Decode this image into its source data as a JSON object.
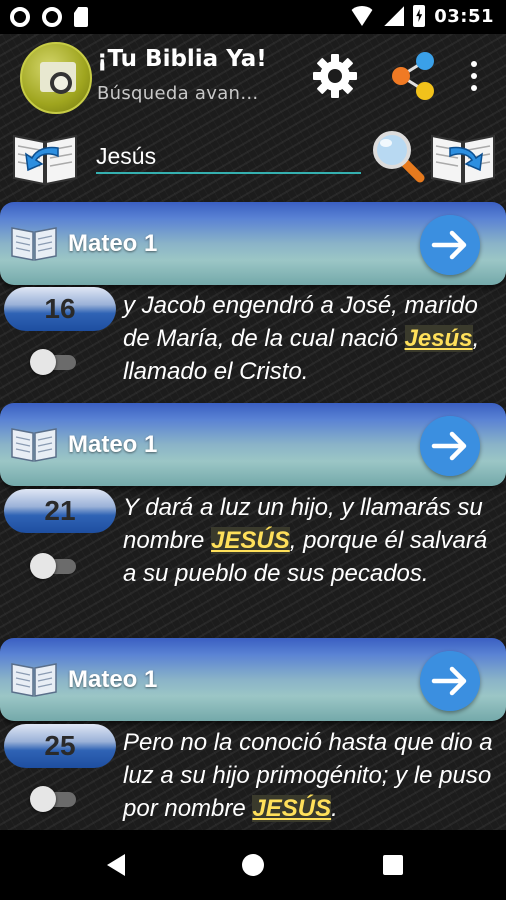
{
  "status_bar": {
    "time": "03:51"
  },
  "app_bar": {
    "title": "¡Tu Biblia Ya!",
    "subtitle": "Búsqueda avan…"
  },
  "search": {
    "value": "Jesús"
  },
  "results": [
    {
      "book_label": "Mateo 1",
      "verse_number": "16",
      "text_before": "y Jacob engendró a José, marido de María, de la cual nació ",
      "highlight": "Jesús",
      "text_after": ", llamado el Cristo.",
      "selected": false
    },
    {
      "book_label": "Mateo 1",
      "verse_number": "21",
      "text_before": "Y dará a luz un hijo, y llamarás su nombre ",
      "highlight": "JESÚS",
      "text_after": ", porque él salvará a su pueblo de sus pecados.",
      "selected": false
    },
    {
      "book_label": "Mateo 1",
      "verse_number": "25",
      "text_before": "Pero no la conoció hasta que dio a luz a su hijo primogénito; y le puso por nombre ",
      "highlight": "JESÚS",
      "text_after": ".",
      "selected": false
    }
  ],
  "colors": {
    "header_blue": "#3a5fc2",
    "go_button": "#3b8fe0",
    "highlight_text": "#ffe05a",
    "search_underline": "#35b0b0",
    "logo_olive": "#9fa51f"
  }
}
